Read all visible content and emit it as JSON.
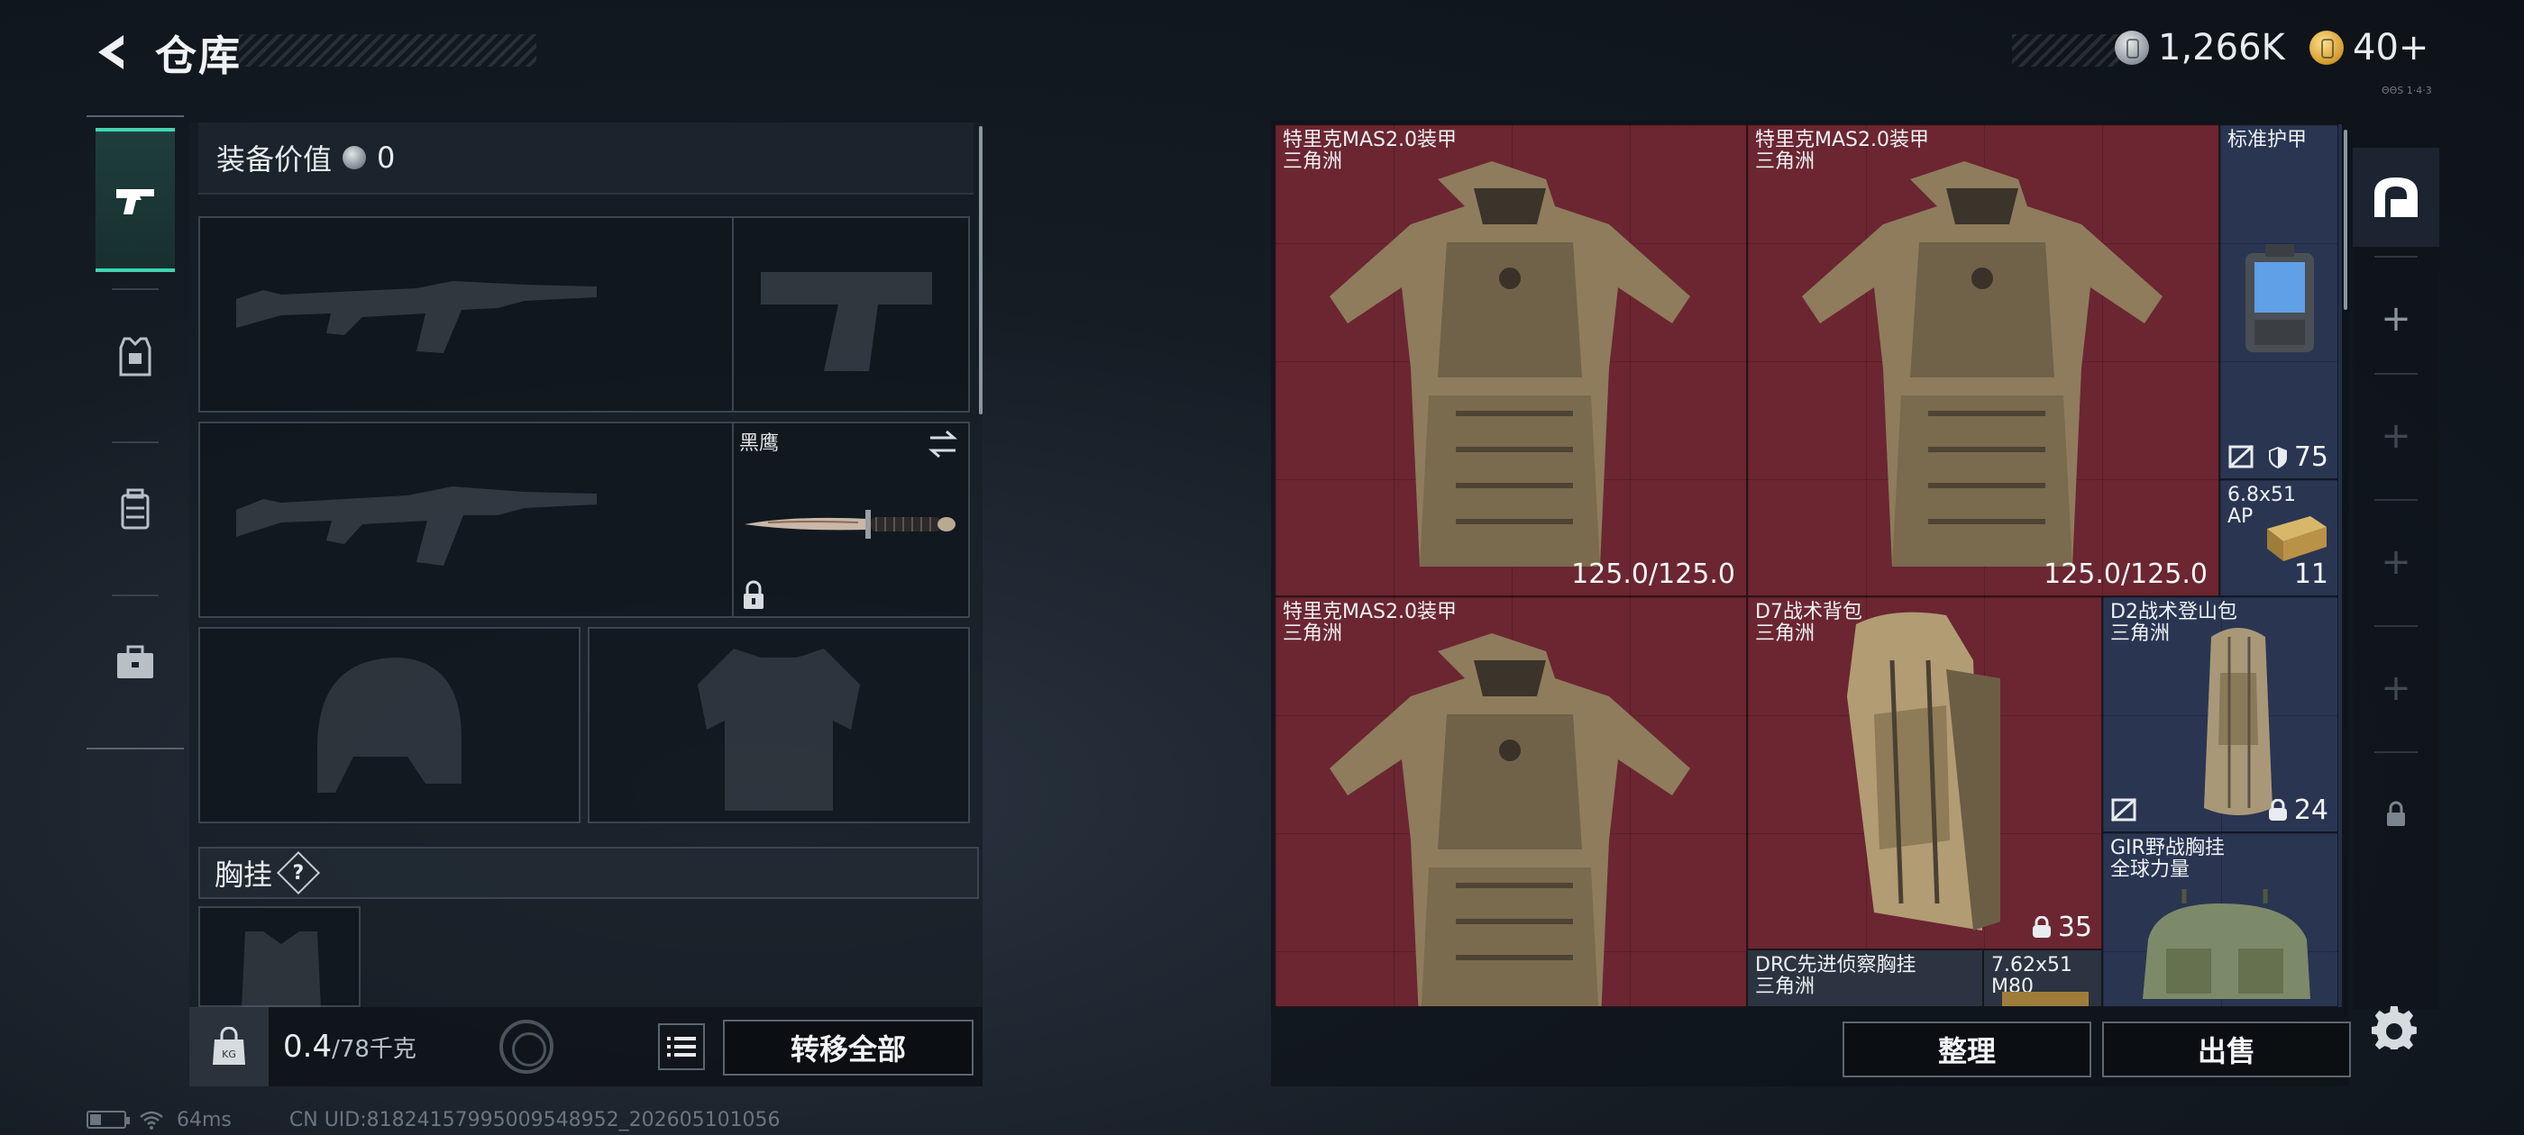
{
  "header": {
    "title": "仓库",
    "currency": [
      {
        "icon": "silver-coin-icon",
        "value": "1,266K"
      },
      {
        "icon": "gold-coin-icon",
        "value": "40+"
      }
    ],
    "tiny_note": "ΘΘS 1·4·3"
  },
  "side_tabs": [
    {
      "icon": "pistol-icon",
      "active": true
    },
    {
      "icon": "armor-vest-icon",
      "active": false
    },
    {
      "icon": "chest-rig-icon",
      "active": false
    },
    {
      "icon": "briefcase-icon",
      "active": false
    }
  ],
  "equipment": {
    "value_label": "装备价值",
    "value": "0",
    "melee_name": "黑鹰",
    "chest_rig_label": "胸挂",
    "help": "?"
  },
  "weight": {
    "current": "0.4",
    "max": "/78千克"
  },
  "buttons": {
    "transfer_all": "转移全部",
    "sort": "整理",
    "sell": "出售"
  },
  "stash": {
    "items": [
      {
        "name": "特里克MAS2.0装甲",
        "sub": "三角洲",
        "durability": "125.0/125.0"
      },
      {
        "name": "特里克MAS2.0装甲",
        "sub": "三角洲",
        "durability": "125.0/125.0"
      },
      {
        "name": "标准护甲",
        "count": "75"
      },
      {
        "name": "6.8x51",
        "sub": "AP",
        "count": "11"
      },
      {
        "name": "特里克MAS2.0装甲",
        "sub": "三角洲"
      },
      {
        "name": "D7战术背包",
        "sub": "三角洲",
        "count": "35"
      },
      {
        "name": "D2战术登山包",
        "sub": "三角洲",
        "count": "24"
      },
      {
        "name": "GIR野战胸挂",
        "sub": "全球力量"
      },
      {
        "name": "DRC先进侦察胸挂",
        "sub": "三角洲"
      },
      {
        "name": "7.62x51",
        "sub": "M80"
      }
    ],
    "side_plus": [
      "+",
      "+",
      "+",
      "+"
    ]
  },
  "footer": {
    "ping": "64ms",
    "uid": "CN UID:81824157995009548952_202605101056"
  },
  "colors": {
    "accent": "#3fd4b0",
    "red_cell": "#6b2631",
    "blue_cell": "#2a3552"
  }
}
